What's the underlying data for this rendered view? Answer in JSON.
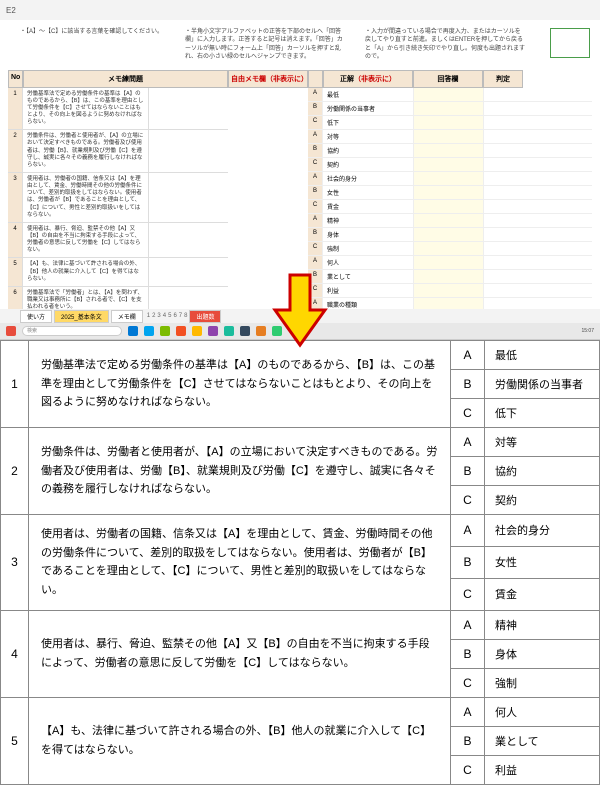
{
  "excel": {
    "cell_ref": "E2",
    "notes": {
      "left": "・【A】～【C】に該当する言葉を確認してください。",
      "mid": "・半角小文字アルファベットの正答を下部のセルへ「回答欄」に入力します。正答すると記号は消えます。「回答」カーソルが無い時にフォーム上「回答」カーソルを押すと乱れ、右の小さい緑のセルへジャンプできます。",
      "right": "・入力が間違っている場合で再度入力、またはカーソルを戻してやり直すと前進。ましくはENTERを押してから戻ると「A」から引き続き矢印でやり直し。何度も出題されますので。"
    },
    "headers": {
      "no": "No",
      "memo_q": "メモ練問題",
      "free_memo": "自由メモ欄（非表示に）",
      "letter": "",
      "seikai": "正解（非表示に）",
      "kaito": "回答欄",
      "hantei": "判定"
    },
    "rows": [
      {
        "no": "1",
        "q": "労働基準法で定める労働条件の基準は【A】のものであるから、【B】は、この基準を理由として労働条件を【C】させてはならないことはもとより、その向上を図るように努めなければならない。"
      },
      {
        "no": "2",
        "q": "労働条件は、労働者と使用者が、【A】の立場において決定すべきものである。労働者及び使用者は、労働【B】、就業規則及び労働【C】を遵守し、誠実に各々その義務を履行しなければならない。"
      },
      {
        "no": "3",
        "q": "使用者は、労働者の国籍、信条又は【A】を理由として、賃金、労働時間その他の労働条件について、差別的取扱をしてはならない。使用者は、労働者が【B】であることを理由として、【C】について、男性と差別的取扱いをしてはならない。"
      },
      {
        "no": "4",
        "q": "使用者は、暴行、脅迫、監禁その他【A】又【B】の自由を不当に拘束する手段によって、労働者の意思に反して労働を【C】してはならない。"
      },
      {
        "no": "5",
        "q": "【A】も、法律に基づいて許される場合の外、【B】他人の就業に介入して【C】を得てはならない。"
      },
      {
        "no": "6",
        "q": "労働基準法で「労働者」とは、【A】を問わず、職業又は事務所に【B】される者で、【C】を支払われる者をいう。"
      }
    ],
    "answers": [
      {
        "l": "A",
        "v": "最低"
      },
      {
        "l": "B",
        "v": "労働関係の当事者"
      },
      {
        "l": "C",
        "v": "低下"
      },
      {
        "l": "A",
        "v": "対等"
      },
      {
        "l": "B",
        "v": "協約"
      },
      {
        "l": "C",
        "v": "契約"
      },
      {
        "l": "A",
        "v": "社会的身分"
      },
      {
        "l": "B",
        "v": "女性"
      },
      {
        "l": "C",
        "v": "賃金"
      },
      {
        "l": "A",
        "v": "精神"
      },
      {
        "l": "B",
        "v": "身体"
      },
      {
        "l": "C",
        "v": "強制"
      },
      {
        "l": "A",
        "v": "何人"
      },
      {
        "l": "B",
        "v": "業として"
      },
      {
        "l": "C",
        "v": "利益"
      },
      {
        "l": "A",
        "v": "職業の種類"
      },
      {
        "l": "B",
        "v": ""
      },
      {
        "l": "C",
        "v": ""
      }
    ],
    "tabs": {
      "t1": "使い方",
      "t2": "2025_基本条文",
      "t3": "メモ欄",
      "nums": [
        "1",
        "2",
        "3",
        "4",
        "5",
        "6",
        "7",
        "8"
      ],
      "more": "出題数"
    },
    "taskbar": {
      "search": "検索",
      "time": "15:07"
    }
  },
  "zoom": {
    "rows": [
      {
        "no": "1",
        "q": "労働基準法で定める労働条件の基準は【A】のものであるから、【B】は、この基準を理由として労働条件を【C】させてはならないことはもとより、その向上を図るように努めなければならない。",
        "a": [
          {
            "l": "A",
            "v": "最低"
          },
          {
            "l": "B",
            "v": "労働関係の当事者"
          },
          {
            "l": "C",
            "v": "低下"
          }
        ]
      },
      {
        "no": "2",
        "q": "労働条件は、労働者と使用者が、【A】の立場において決定すべきものである。労働者及び使用者は、労働【B】、就業規則及び労働【C】を遵守し、誠実に各々その義務を履行しなければならない。",
        "a": [
          {
            "l": "A",
            "v": "対等"
          },
          {
            "l": "B",
            "v": "協約"
          },
          {
            "l": "C",
            "v": "契約"
          }
        ]
      },
      {
        "no": "3",
        "q": "使用者は、労働者の国籍、信条又は【A】を理由として、賃金、労働時間その他の労働条件について、差別的取扱をしてはならない。使用者は、労働者が【B】であることを理由として、【C】について、男性と差別的取扱いをしてはならない。",
        "a": [
          {
            "l": "A",
            "v": "社会的身分"
          },
          {
            "l": "B",
            "v": "女性"
          },
          {
            "l": "C",
            "v": "賃金"
          }
        ]
      },
      {
        "no": "4",
        "q": "使用者は、暴行、脅迫、監禁その他【A】又【B】の自由を不当に拘束する手段によって、労働者の意思に反して労働を【C】してはならない。",
        "a": [
          {
            "l": "A",
            "v": "精神"
          },
          {
            "l": "B",
            "v": "身体"
          },
          {
            "l": "C",
            "v": "強制"
          }
        ]
      },
      {
        "no": "5",
        "q": "【A】も、法律に基づいて許される場合の外、【B】他人の就業に介入して【C】を得てはならない。",
        "a": [
          {
            "l": "A",
            "v": "何人"
          },
          {
            "l": "B",
            "v": "業として"
          },
          {
            "l": "C",
            "v": "利益"
          }
        ]
      }
    ]
  }
}
